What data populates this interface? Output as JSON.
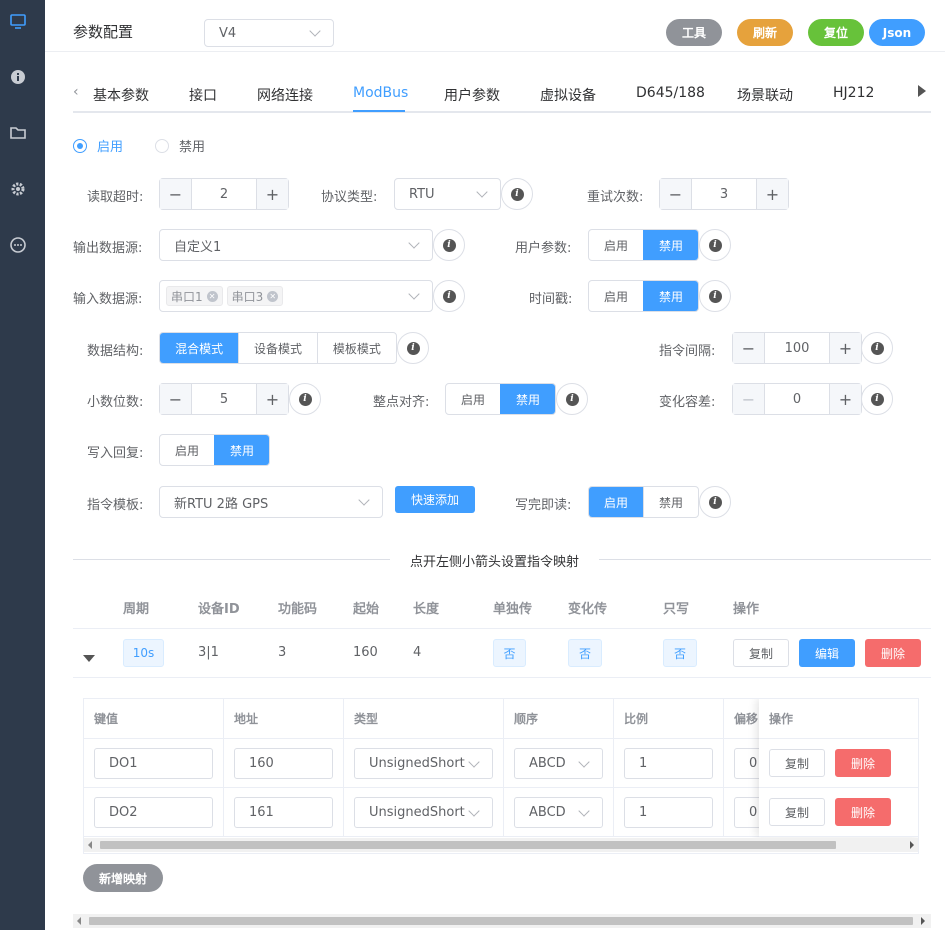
{
  "sidebar": {
    "icons": [
      "monitor-icon",
      "info-icon",
      "folder-icon",
      "gear-icon",
      "chat-icon"
    ]
  },
  "header": {
    "title": "参数配置",
    "version": "V4",
    "buttons": {
      "tools": "工具",
      "refresh": "刷新",
      "reset": "复位",
      "json": "Json"
    }
  },
  "tabs": [
    "基本参数",
    "接口",
    "网络连接",
    "ModBus",
    "用户参数",
    "虚拟设备",
    "D645/188",
    "场景联动",
    "HJ212"
  ],
  "active_tab": "ModBus",
  "enable": {
    "on": "启用",
    "off": "禁用",
    "selected": "启用"
  },
  "form": {
    "read_timeout": {
      "label": "读取超时:",
      "value": "2"
    },
    "protocol": {
      "label": "协议类型:",
      "value": "RTU"
    },
    "retry": {
      "label": "重试次数:",
      "value": "3"
    },
    "output_source": {
      "label": "输出数据源:",
      "value": "自定义1"
    },
    "user_params": {
      "label": "用户参数:",
      "on": "启用",
      "off": "禁用"
    },
    "input_source": {
      "label": "输入数据源:",
      "tags": [
        "串口1",
        "串口3"
      ]
    },
    "timestamp": {
      "label": "时间戳:",
      "on": "启用",
      "off": "禁用"
    },
    "data_struct": {
      "label": "数据结构:",
      "options": [
        "混合模式",
        "设备模式",
        "模板模式"
      ],
      "selected": "混合模式"
    },
    "cmd_interval": {
      "label": "指令间隔:",
      "value": "100"
    },
    "decimals": {
      "label": "小数位数:",
      "value": "5"
    },
    "hour_align": {
      "label": "整点对齐:",
      "on": "启用",
      "off": "禁用"
    },
    "change_tol": {
      "label": "变化容差:",
      "value": "0"
    },
    "write_reply": {
      "label": "写入回复:",
      "on": "启用",
      "off": "禁用"
    },
    "cmd_template": {
      "label": "指令模板:",
      "value": "新RTU 2路 GPS",
      "quick_add": "快速添加"
    },
    "read_after_write": {
      "label": "写完即读:",
      "on": "启用",
      "off": "禁用"
    }
  },
  "divider_text": "点开左侧小箭头设置指令映射",
  "cmd_table": {
    "headers": [
      "周期",
      "设备ID",
      "功能码",
      "起始",
      "长度",
      "单独传",
      "变化传",
      "只写",
      "操作"
    ],
    "row": {
      "period": "10s",
      "device_id": "3|1",
      "func": "3",
      "start": "160",
      "length": "4",
      "single": "否",
      "change": "否",
      "write_only": "否",
      "copy": "复制",
      "edit": "编辑",
      "delete": "删除"
    }
  },
  "map_table": {
    "headers": [
      "键值",
      "地址",
      "类型",
      "顺序",
      "比例",
      "偏移",
      "操作"
    ],
    "rows": [
      {
        "key": "DO1",
        "addr": "160",
        "type": "UnsignedShort",
        "order": "ABCD",
        "scale": "1",
        "offset": "0",
        "copy": "复制",
        "delete": "删除"
      },
      {
        "key": "DO2",
        "addr": "161",
        "type": "UnsignedShort",
        "order": "ABCD",
        "scale": "1",
        "offset": "0",
        "copy": "复制",
        "delete": "删除"
      }
    ],
    "add_button": "新增映射"
  },
  "colors": {
    "primary": "#409eff",
    "danger": "#f56c6c",
    "gray": "#909399",
    "orange": "#e6a23c",
    "green": "#67c23a",
    "sidebar": "#2e3a4b"
  }
}
